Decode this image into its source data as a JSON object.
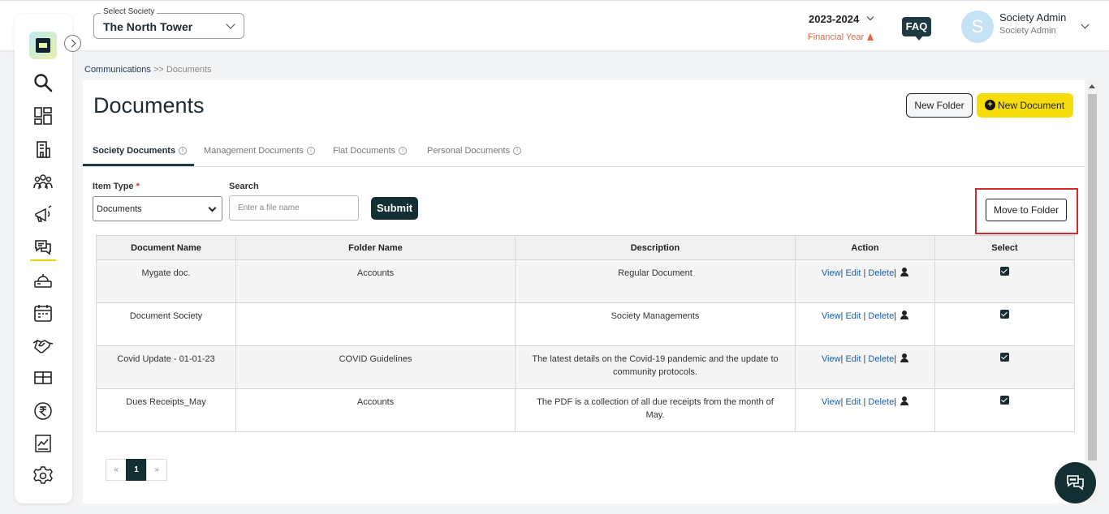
{
  "header": {
    "society_select": {
      "label": "Select Society",
      "value": "The North Tower"
    },
    "year": "2023-2024",
    "financial_year": "Financial Year",
    "faq": "FAQ",
    "user": {
      "initial": "S",
      "name": "Society Admin",
      "role": "Society Admin"
    }
  },
  "sidebar": {
    "items": [
      "search-icon",
      "dashboard-icon",
      "building-icon",
      "residents-icon",
      "announcements-icon",
      "communications-icon",
      "helpdesk-icon",
      "calendar-icon",
      "vendors-icon",
      "amenities-icon",
      "rupee-icon",
      "reports-icon",
      "settings-icon"
    ],
    "active": "communications-icon",
    "accent": "#e6d400"
  },
  "breadcrumb": {
    "parent": "Communications",
    "separator": " >> ",
    "current": "Documents"
  },
  "page": {
    "title": "Documents",
    "new_folder": "New Folder",
    "new_document": "New Document",
    "accent": "#f7dc0c"
  },
  "tabs": [
    {
      "label": "Society Documents",
      "active": true
    },
    {
      "label": "Management Documents",
      "active": false
    },
    {
      "label": "Flat Documents",
      "active": false
    },
    {
      "label": "Personal Documents",
      "active": false
    }
  ],
  "filters": {
    "item_type_label": "Item Type",
    "required_mark": "*",
    "item_type_value": "Documents",
    "search_label": "Search",
    "search_placeholder": "Enter a file name",
    "search_value": "",
    "submit": "Submit"
  },
  "move_to_folder": "Move to Folder",
  "table": {
    "headers": [
      "Document Name",
      "Folder Name",
      "Description",
      "Action",
      "Select"
    ],
    "action_labels": {
      "view": "View",
      "edit": "Edit",
      "delete": "Delete"
    },
    "rows": [
      {
        "name": "Mygate doc.",
        "folder": "Accounts",
        "description": "Regular Document",
        "selected": true
      },
      {
        "name": "Document Society",
        "folder": "",
        "description": "Society Managements",
        "selected": true
      },
      {
        "name": "Covid Update - 01-01-23",
        "folder": "COVID Guidelines",
        "description": "The latest details on the Covid-19 pandemic and the update to community protocols.",
        "selected": true
      },
      {
        "name": "Dues Receipts_May",
        "folder": "Accounts",
        "description": "The PDF is a collection of all due receipts from the month of May.",
        "selected": true
      }
    ]
  },
  "pagination": {
    "prev": "«",
    "current": "1",
    "next": "»"
  },
  "colors": {
    "primary_dark": "#142f33",
    "link": "#1d5fa7",
    "warning": "#e8643c",
    "highlight": "#d42a2a"
  }
}
